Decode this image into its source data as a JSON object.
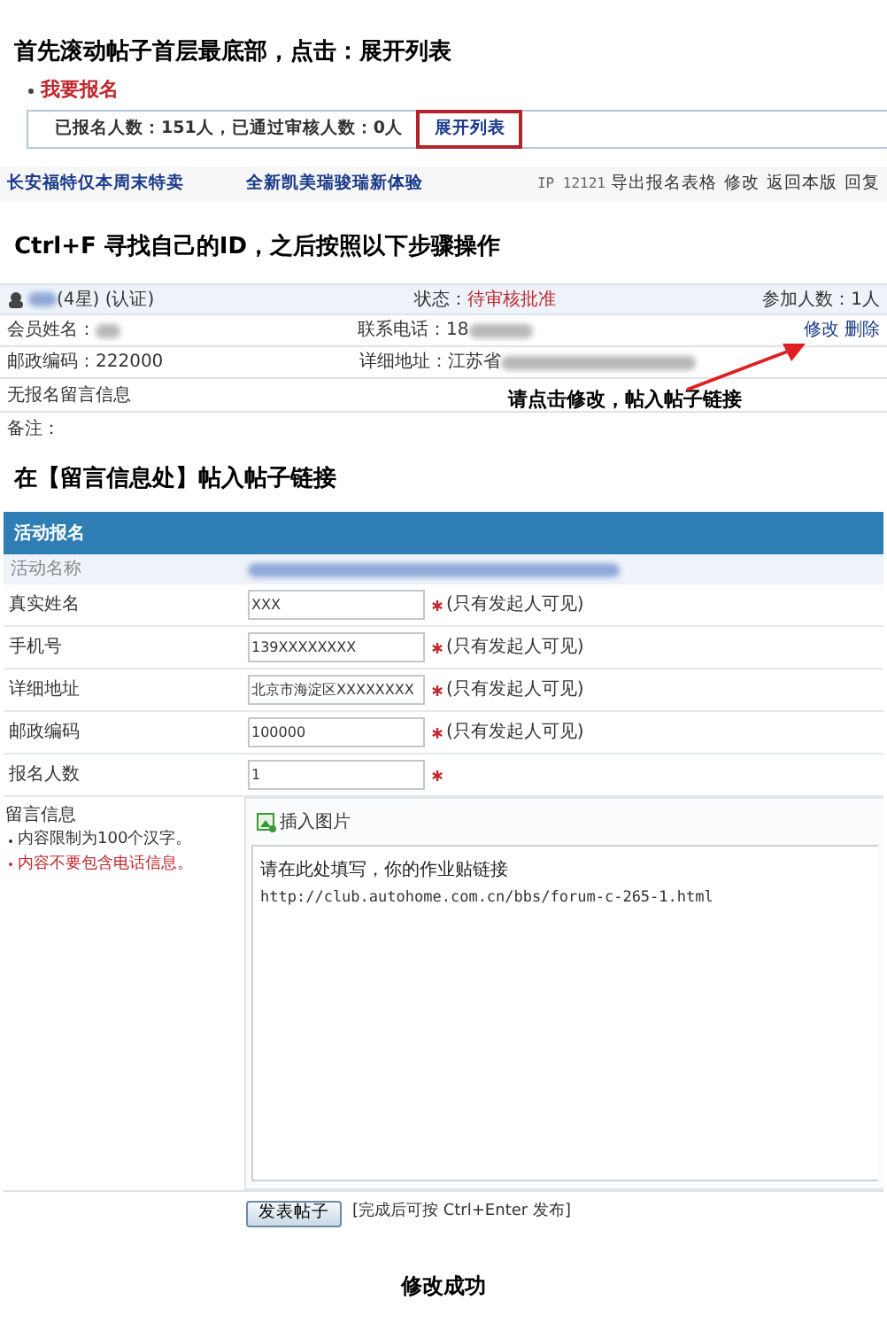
{
  "instruction_1": "首先滚动帖子首层最底部，点击：展开列表",
  "signup_box": {
    "heading": "我要报名",
    "summary": "已报名人数：151人，已通过审核人数：0人",
    "expand_link": "展开列表"
  },
  "link_bar": {
    "ads": [
      "长安福特仅本周末特卖",
      "全新凯美瑞骏瑞新体验"
    ],
    "ip": "IP 12121",
    "actions": [
      "导出报名表格",
      "修改",
      "返回本版",
      "回复"
    ]
  },
  "instruction_2": "Ctrl+F 寻找自己的ID，之后按照以下步骤操作",
  "registrant": {
    "user_suffix": "(4星) (认证)",
    "status_label": "状态：",
    "status": "待审核批准",
    "participants": "参加人数：1人",
    "name_label": "会员姓名：",
    "phone_label": "联系电话：18",
    "actions": [
      "修改",
      "删除"
    ],
    "postcode": "邮政编码：222000",
    "address_label": "详细地址：江苏省",
    "message": "无报名留言信息",
    "remark": "备注："
  },
  "annotation": "请点击修改，帖入帖子链接",
  "instruction_3": "在【留言信息处】帖入帖子链接",
  "form": {
    "title": "活动报名",
    "activity_label": "活动名称",
    "fields": [
      {
        "label": "真实姓名",
        "value": "XXX",
        "required": true,
        "note": "(只有发起人可见)"
      },
      {
        "label": "手机号",
        "value": "139XXXXXXXX",
        "required": true,
        "note": "(只有发起人可见)"
      },
      {
        "label": "详细地址",
        "value": "北京市海淀区XXXXXXXX",
        "required": true,
        "note": "(只有发起人可见)"
      },
      {
        "label": "邮政编码",
        "value": "100000",
        "required": true,
        "note": "(只有发起人可见)"
      },
      {
        "label": "报名人数",
        "value": "1",
        "required": true
      }
    ],
    "message": {
      "label": "留言信息",
      "hints": [
        {
          "text": "内容限制为100个汉字。",
          "warning": false
        },
        {
          "text": "内容不要包含电话信息。",
          "warning": true
        }
      ],
      "toolbar_button": "插入图片",
      "lines": [
        "请在此处填写，你的作业贴链接",
        "http://club.autohome.com.cn/bbs/forum-c-265-1.html"
      ]
    },
    "submit": "发表帖子",
    "submit_hint": "[完成后可按 Ctrl+Enter 发布]"
  },
  "instruction_4": "修改成功"
}
